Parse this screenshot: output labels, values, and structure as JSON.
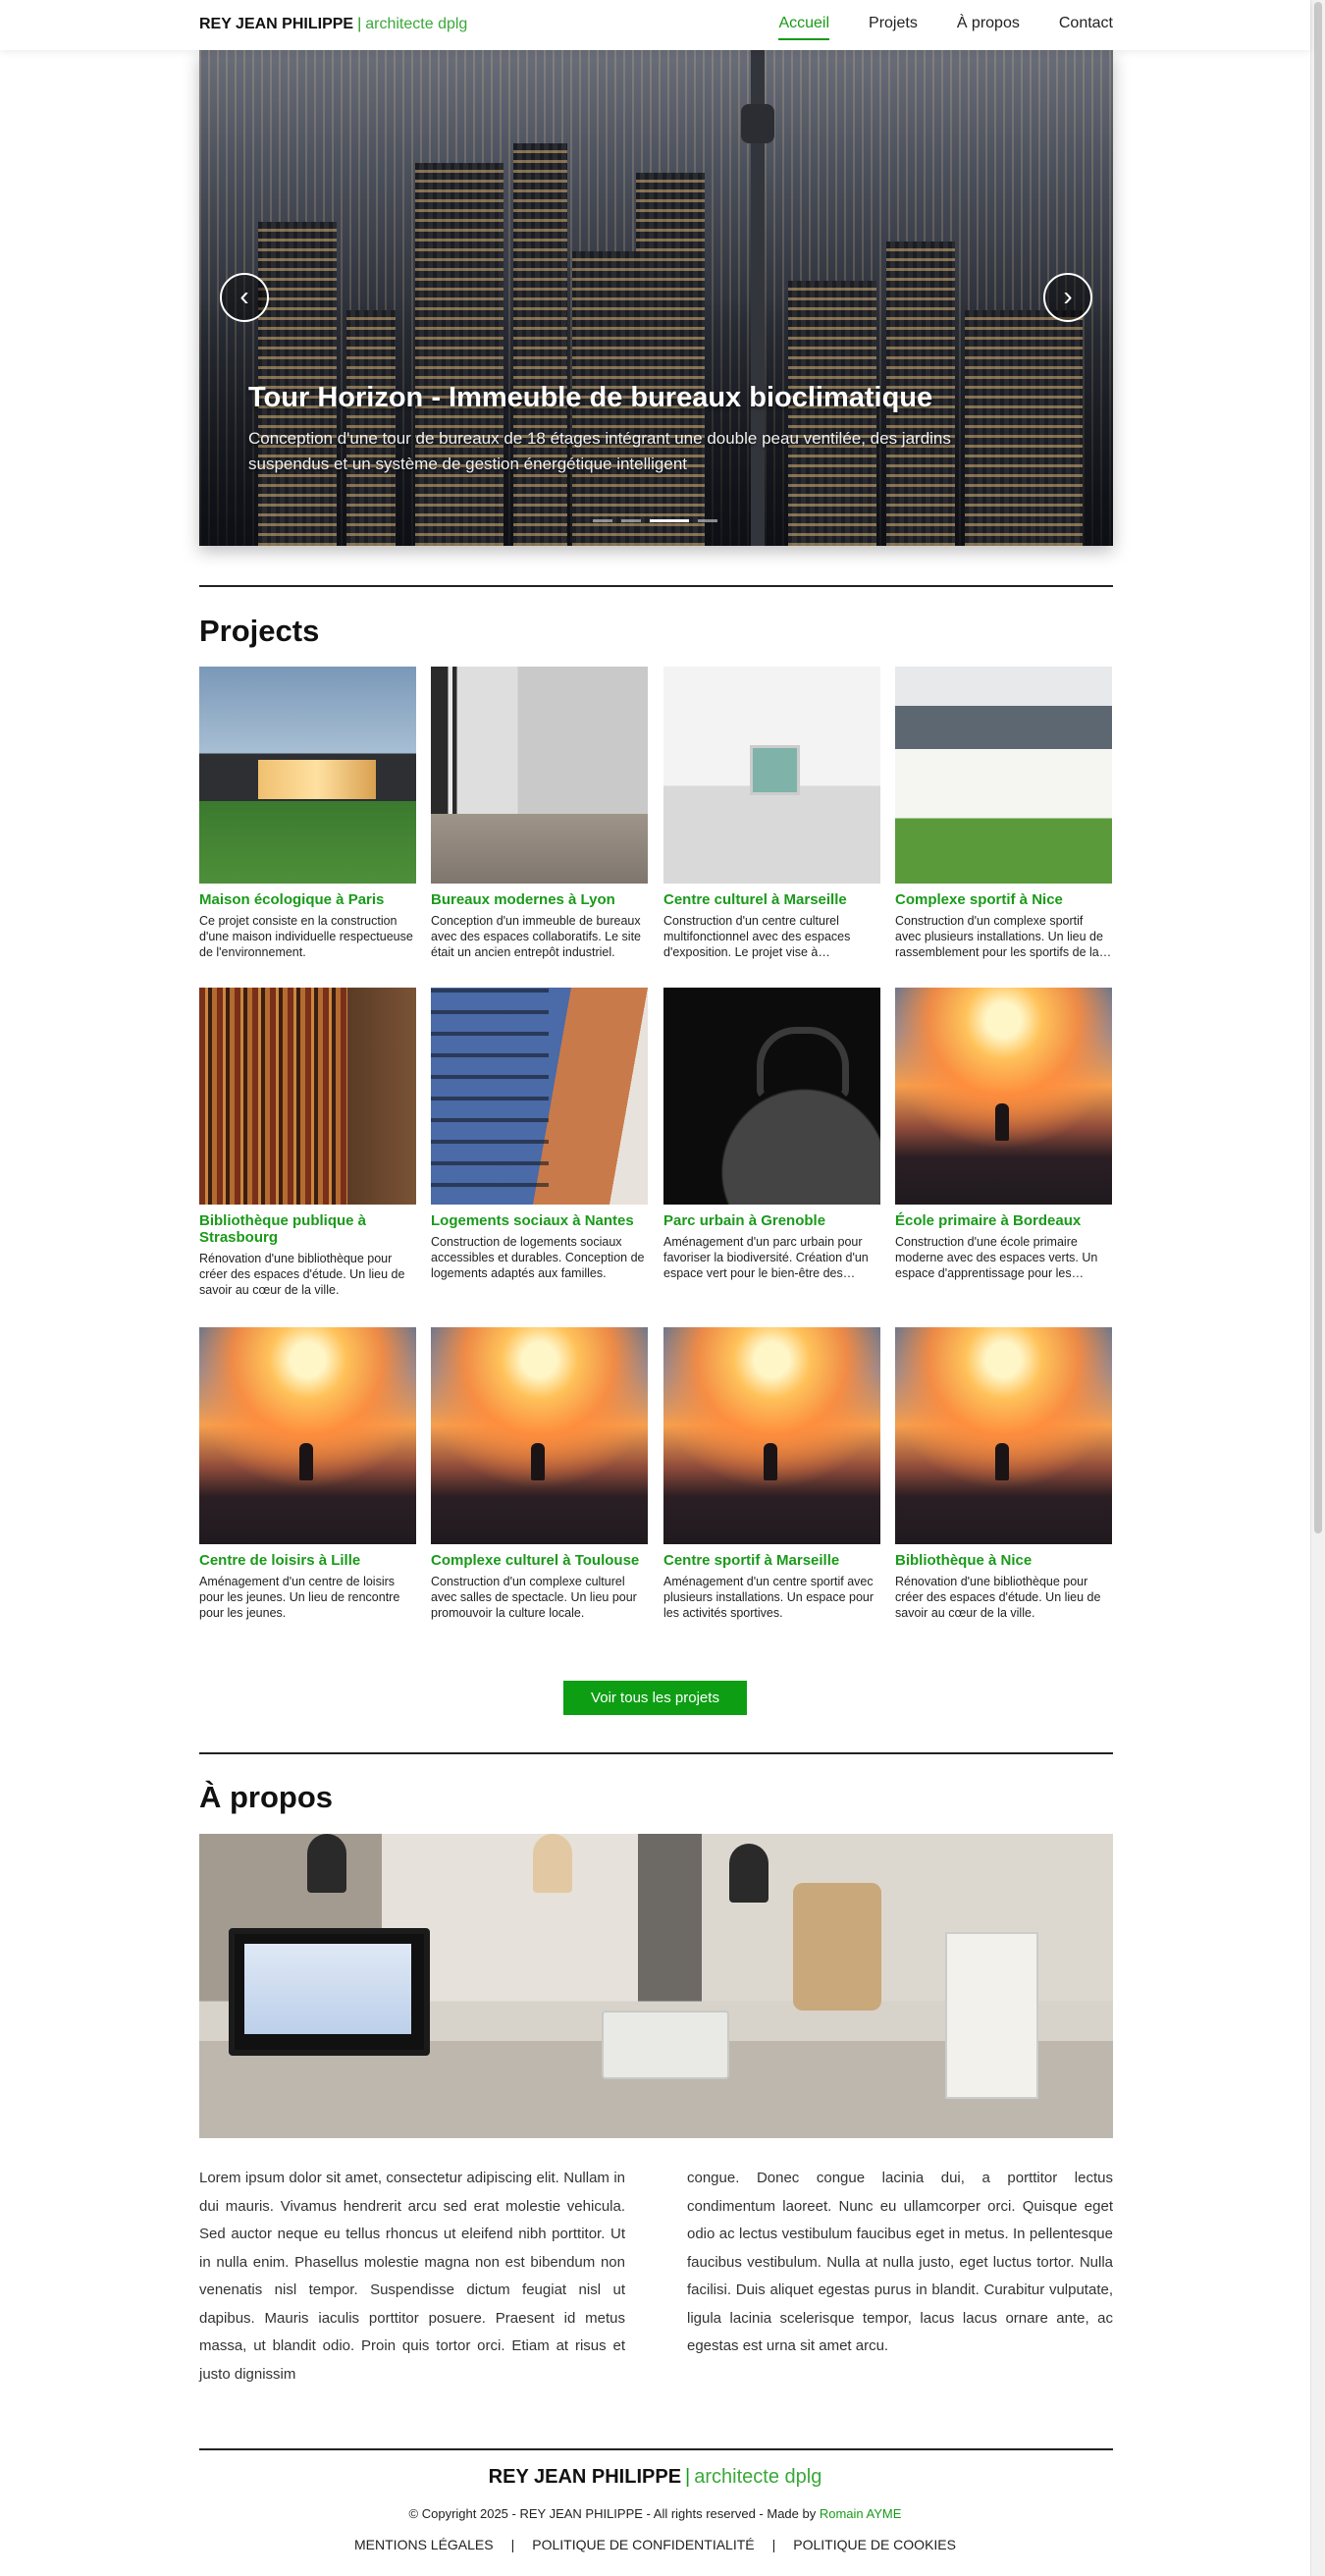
{
  "header": {
    "brand_name": "REY JEAN PHILIPPE",
    "brand_separator": "|",
    "brand_subtitle": "architecte dplg",
    "nav": [
      {
        "label": "Accueil",
        "active": true
      },
      {
        "label": "Projets",
        "active": false
      },
      {
        "label": "À propos",
        "active": false
      },
      {
        "label": "Contact",
        "active": false
      }
    ]
  },
  "hero": {
    "title": "Tour Horizon - Immeuble de bureaux bioclimatique",
    "description": "Conception d'une tour de bureaux de 18 étages intégrant une double peau ventilée, des jardins suspendus et un système de gestion énergétique intelligent",
    "prev_icon": "chevron-left-icon",
    "next_icon": "chevron-right-icon",
    "prev_glyph": "‹",
    "next_glyph": "›",
    "slide_count": 4,
    "active_slide": 3
  },
  "projects": {
    "title": "Projects",
    "items": [
      {
        "title": "Maison écologique à Paris",
        "description": "Ce projet consiste en la construction d'une maison individuelle respectueuse de l'environnement.",
        "image": "house"
      },
      {
        "title": "Bureaux modernes à Lyon",
        "description": "Conception d'un immeuble de bureaux avec des espaces collaboratifs. Le site était un ancien entrepôt industriel.",
        "image": "office"
      },
      {
        "title": "Centre culturel à Marseille",
        "description": "Construction d'un centre culturel multifonctionnel avec des espaces d'exposition. Le projet vise à promouvoir la culture locale.",
        "image": "gallery"
      },
      {
        "title": "Complexe sportif à Nice",
        "description": "Construction d'un complexe sportif avec plusieurs installations. Un lieu de rassemblement pour les sportifs de la région.",
        "image": "villa"
      },
      {
        "title": "Bibliothèque publique à Strasbourg",
        "description": "Rénovation d'une bibliothèque pour créer des espaces d'étude. Un lieu de savoir au cœur de la ville.",
        "image": "library"
      },
      {
        "title": "Logements sociaux à Nantes",
        "description": "Construction de logements sociaux accessibles et durables. Conception de logements adaptés aux familles.",
        "image": "building"
      },
      {
        "title": "Parc urbain à Grenoble",
        "description": "Aménagement d'un parc urbain pour favoriser la biodiversité. Création d'un espace vert pour le bien-être des habitants.",
        "image": "bike"
      },
      {
        "title": "École primaire à Bordeaux",
        "description": "Construction d'une école primaire moderne avec des espaces verts. Un espace d'apprentissage pour les enfants.",
        "image": "sunset"
      },
      {
        "title": "Centre de loisirs à Lille",
        "description": "Aménagement d'un centre de loisirs pour les jeunes. Un lieu de rencontre pour les jeunes.",
        "image": "sunset"
      },
      {
        "title": "Complexe culturel à Toulouse",
        "description": "Construction d'un complexe culturel avec salles de spectacle. Un lieu pour promouvoir la culture locale.",
        "image": "sunset"
      },
      {
        "title": "Centre sportif à Marseille",
        "description": "Aménagement d'un centre sportif avec plusieurs installations. Un espace pour les activités sportives.",
        "image": "sunset"
      },
      {
        "title": "Bibliothèque à Nice",
        "description": "Rénovation d'une bibliothèque pour créer des espaces d'étude. Un lieu de savoir au cœur de la ville.",
        "image": "sunset"
      }
    ],
    "view_all_label": "Voir tous les projets"
  },
  "about": {
    "title": "À propos",
    "column_left": "Lorem ipsum dolor sit amet, consectetur adipiscing elit. Nullam in dui mauris. Vivamus hendrerit arcu sed erat molestie vehicula. Sed auctor neque eu tellus rhoncus ut eleifend nibh porttitor. Ut in nulla enim. Phasellus molestie magna non est bibendum non venenatis nisl tempor. Suspendisse dictum feugiat nisl ut dapibus. Mauris iaculis porttitor posuere. Praesent id metus massa, ut blandit odio. Proin quis tortor orci. Etiam at risus et justo dignissim",
    "column_right": "congue. Donec congue lacinia dui, a porttitor lectus condimentum laoreet. Nunc eu ullamcorper orci. Quisque eget odio ac lectus vestibulum faucibus eget in metus. In pellentesque faucibus vestibulum. Nulla at nulla justo, eget luctus tortor. Nulla facilisi. Duis aliquet egestas purus in blandit. Curabitur vulputate, ligula lacinia scelerisque tempor, lacus lacus ornare ante, ac egestas est urna sit amet arcu."
  },
  "footer": {
    "brand_name": "REY JEAN PHILIPPE",
    "brand_separator": "|",
    "brand_subtitle": "architecte dplg",
    "copyright_prefix": "© Copyright 2025 - REY JEAN PHILIPPE - All rights reserved - Made by",
    "author": "Romain AYME",
    "links": [
      "MENTIONS LÉGALES",
      "POLITIQUE DE CONFIDENTIALITÉ",
      "POLITIQUE DE COOKIES"
    ],
    "link_separator": "|"
  },
  "colors": {
    "accent": "#1a9a1a",
    "button": "#0e9e14",
    "text": "#111111"
  }
}
